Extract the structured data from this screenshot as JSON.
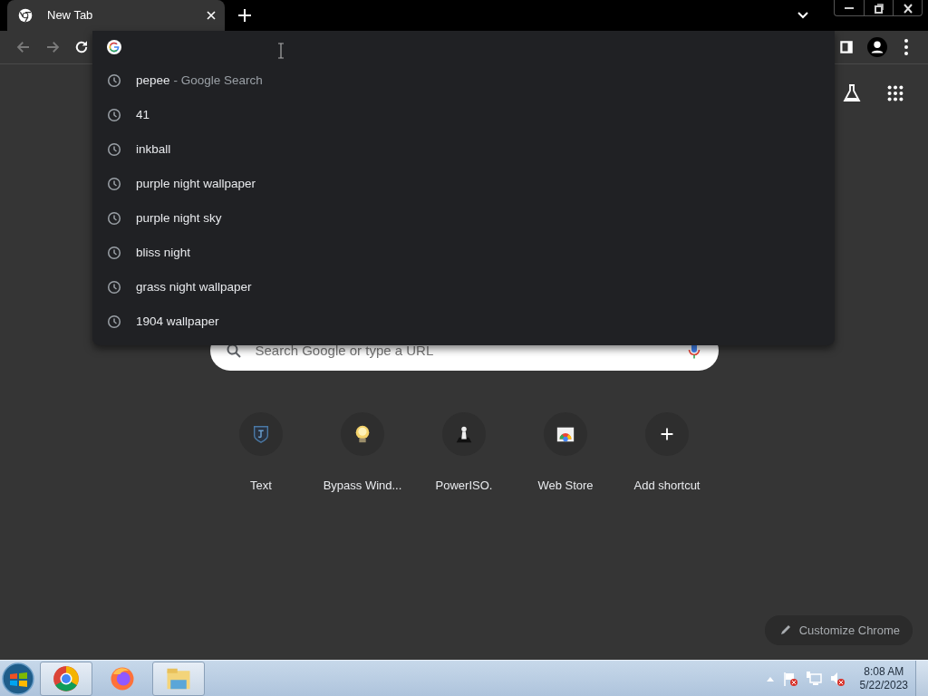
{
  "tabs": [
    {
      "title": "New Tab",
      "selected": true
    }
  ],
  "suggestions": [
    {
      "text": "pepee",
      "detail": "- Google Search"
    },
    {
      "text": "41"
    },
    {
      "text": "inkball"
    },
    {
      "text": "purple night wallpaper"
    },
    {
      "text": "purple night sky"
    },
    {
      "text": "bliss night"
    },
    {
      "text": "grass night wallpaper"
    },
    {
      "text": "1904 wallpaper"
    }
  ],
  "search": {
    "placeholder": "Search Google or type a URL"
  },
  "shortcuts": [
    {
      "label": "Text",
      "kind": "text"
    },
    {
      "label": "Bypass Wind...",
      "kind": "bulb"
    },
    {
      "label": "PowerISO.",
      "kind": "figure"
    },
    {
      "label": "Web Store",
      "kind": "store"
    },
    {
      "label": "Add shortcut",
      "kind": "add"
    }
  ],
  "customize_button": "Customize Chrome",
  "taskbar": {
    "apps": [
      {
        "kind": "chrome",
        "selected": true
      },
      {
        "kind": "firefox",
        "selected": false
      },
      {
        "kind": "explorer",
        "selected": true
      }
    ],
    "time": "8:08 AM",
    "date": "5/22/2023"
  }
}
